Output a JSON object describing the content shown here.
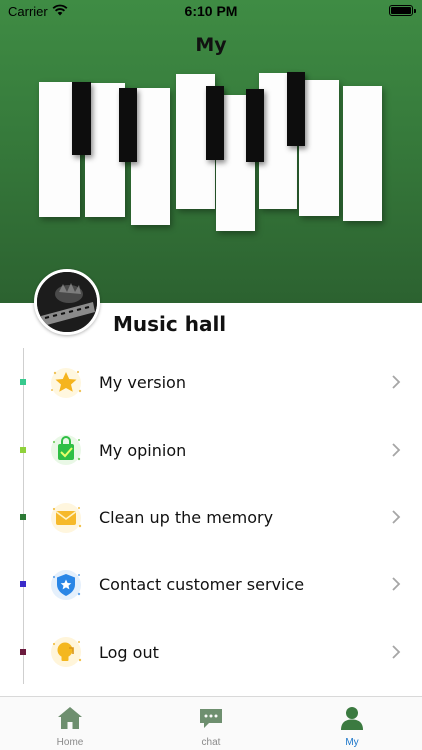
{
  "status_bar": {
    "carrier": "Carrier",
    "time": "6:10 PM"
  },
  "header": {
    "title": "My"
  },
  "profile": {
    "name": "Music hall"
  },
  "menu": {
    "items": [
      {
        "label": "My version",
        "dot_color": "#37c98d",
        "icon": "star-badge-icon"
      },
      {
        "label": "My opinion",
        "dot_color": "#8fd13a",
        "icon": "feedback-bag-icon"
      },
      {
        "label": "Clean up the memory",
        "dot_color": "#2c7a35",
        "icon": "mail-envelope-icon"
      },
      {
        "label": "Contact customer service",
        "dot_color": "#3a2bc9",
        "icon": "shield-star-icon"
      },
      {
        "label": "Log out",
        "dot_color": "#6b1a3d",
        "icon": "logout-bulb-icon"
      }
    ]
  },
  "tab_bar": {
    "tabs": [
      {
        "label": "Home",
        "icon": "home-icon",
        "active": false
      },
      {
        "label": "chat",
        "icon": "chat-bubble-icon",
        "active": false
      },
      {
        "label": "My",
        "icon": "person-icon",
        "active": true
      }
    ],
    "active_color": "#1a75c9",
    "inactive_color": "#8a8a8a",
    "icon_color": "#3b7a40"
  },
  "colors": {
    "header_green": "#367a3b"
  }
}
